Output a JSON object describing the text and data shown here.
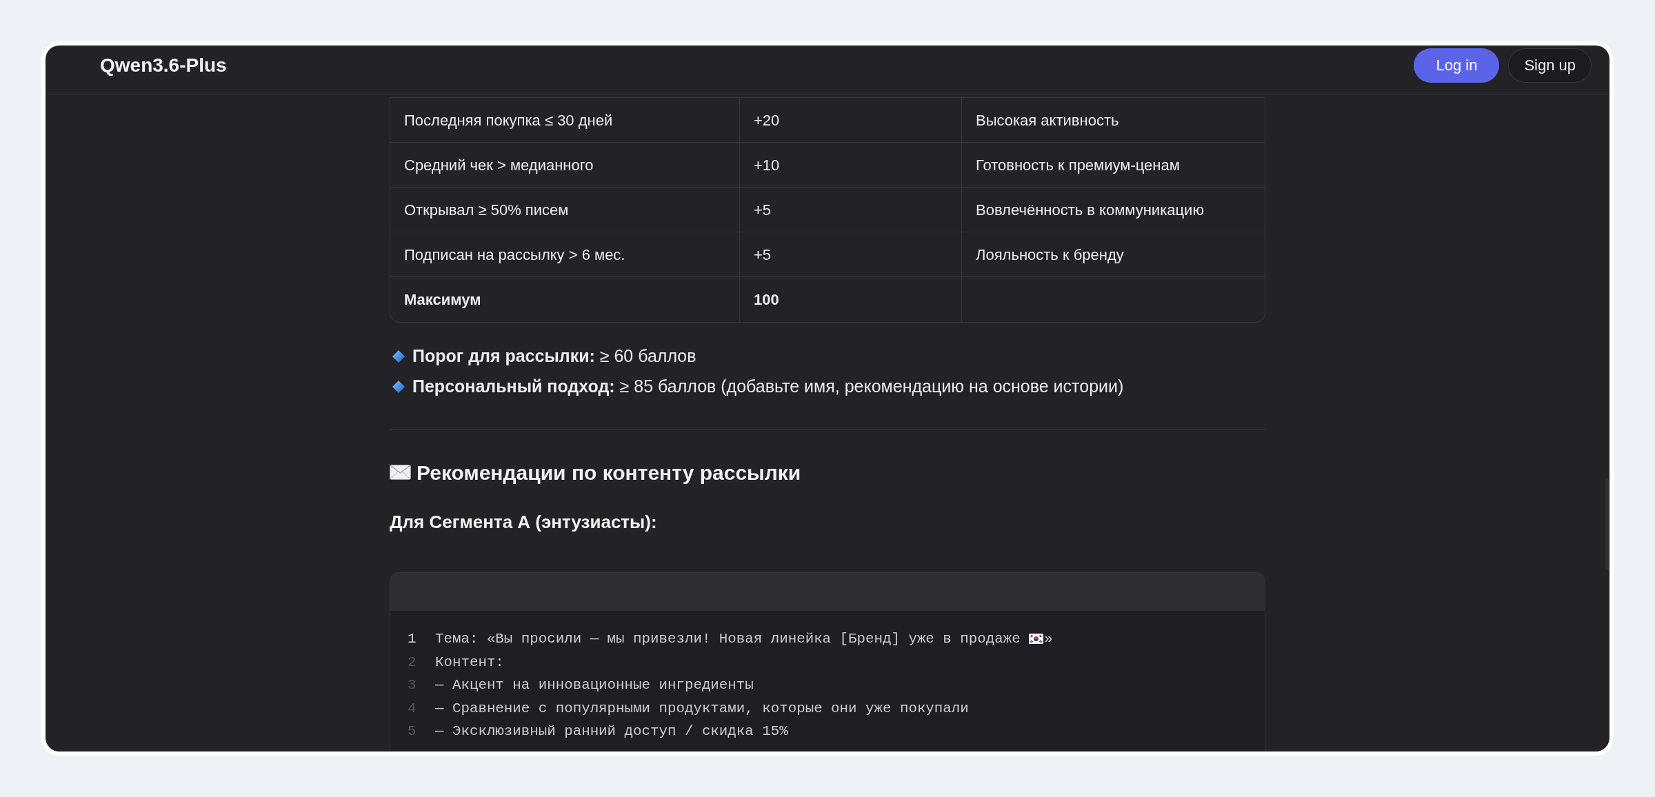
{
  "header": {
    "title": "Qwen3.6-Plus",
    "buttons": [
      {
        "label": "Log in",
        "kind": "primary"
      },
      {
        "label": "Sign up",
        "kind": "secondary"
      }
    ]
  },
  "table": {
    "rows": [
      {
        "kind": "item",
        "cells": [
          "Последняя покупка ≤ 30 дней",
          "+20",
          "Высокая активность"
        ]
      },
      {
        "kind": "item",
        "cells": [
          "Средний чек > медианного",
          "+10",
          "Готовность к премиум-ценам"
        ]
      },
      {
        "kind": "item",
        "cells": [
          "Открывал ≥ 50% писем",
          "+5",
          "Вовлечённость в коммуникацию"
        ]
      },
      {
        "kind": "item",
        "cells": [
          "Подписан на рассылку > 6 мес.",
          "+5",
          "Лояльность к бренду"
        ]
      },
      {
        "kind": "total",
        "cells": [
          "Максимум",
          "100"
        ]
      }
    ]
  },
  "bullets": [
    "**Порог для рассылки:** ≥ 60 баллов",
    "**Персональный подход:** ≥ 85 баллов (добавьте имя, рекомендацию на основе истории)"
  ],
  "section_heading": "Рекомендации по контенту рассылки",
  "subheading": "Для Сегмента А (энтузиасты):",
  "code_block": {
    "lines": [
      {
        "number": "1",
        "active": true,
        "parts": [
          "Тема: «Вы просили — мы привезли! Новая линейка [Бренд] уже в продаже",
          "»"
        ]
      },
      {
        "number": "2",
        "active": false,
        "parts": [
          "Контент:"
        ]
      },
      {
        "number": "3",
        "active": false,
        "parts": [
          "— Акцент на инновационные ингредиенты"
        ]
      },
      {
        "number": "4",
        "active": false,
        "parts": [
          "— Сравнение с популярными продуктами, которые они уже покупали"
        ]
      },
      {
        "number": "5",
        "active": false,
        "parts": [
          "— Эксклюзивный ранний доступ / скидка 15%"
        ]
      }
    ]
  }
}
